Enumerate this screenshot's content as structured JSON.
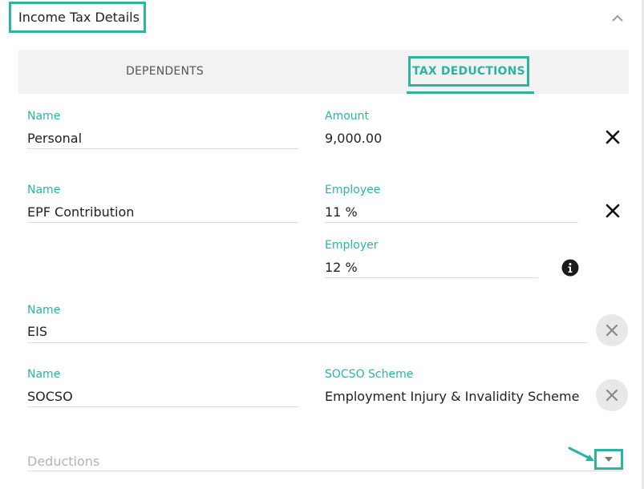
{
  "header": {
    "title": "Income Tax Details"
  },
  "tabs": [
    {
      "label": "DEPENDENTS",
      "active": false
    },
    {
      "label": "TAX DEDUCTIONS",
      "active": true
    }
  ],
  "deductions": {
    "personal": {
      "name_label": "Name",
      "name_value": "Personal",
      "amount_label": "Amount",
      "amount_value": "9,000.00"
    },
    "epf": {
      "name_label": "Name",
      "name_value": "EPF Contribution",
      "employee_label": "Employee",
      "employee_value": "11 %",
      "employer_label": "Employer",
      "employer_value": "12 %"
    },
    "eis": {
      "name_label": "Name",
      "name_value": "EIS"
    },
    "socso": {
      "name_label": "Name",
      "name_value": "SOCSO",
      "scheme_label": "SOCSO Scheme",
      "scheme_value": "Employment Injury & Invalidity Scheme"
    }
  },
  "add_deduction": {
    "placeholder": "Deductions"
  },
  "colors": {
    "accent": "#2bb5a0",
    "text": "#222222",
    "muted": "#b3b3b3",
    "tab_bg": "#f2f2f2"
  },
  "icons": {
    "collapse": "chevron-up-icon",
    "remove": "close-icon",
    "remove_disabled": "close-circle-icon",
    "info": "info-icon",
    "dropdown": "caret-down-icon",
    "hint": "arrow-icon"
  }
}
